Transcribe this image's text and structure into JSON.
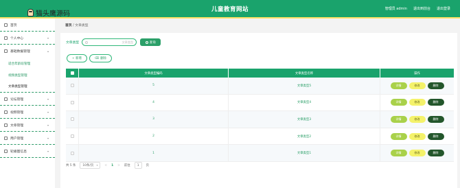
{
  "header": {
    "logo_text": "猫头鹰源码",
    "title": "儿童教育网站",
    "user_label": "管理员 admin",
    "links": [
      "退出到前台",
      "退出登录"
    ]
  },
  "sidebar": {
    "items": [
      {
        "label": "首页",
        "icon": "home-icon",
        "chevron": false
      },
      {
        "label": "个人中心",
        "icon": "user-icon",
        "chevron": true
      },
      {
        "label": "基础数据管理",
        "icon": "database-icon",
        "chevron": true,
        "expanded": true,
        "children": [
          "适合年龄段管理",
          "视频类型管理",
          "文章类型管理"
        ],
        "active_child": 2
      },
      {
        "label": "论坛管理",
        "icon": "forum-icon",
        "chevron": true
      },
      {
        "label": "视频管理",
        "icon": "video-icon",
        "chevron": true
      },
      {
        "label": "文章管理",
        "icon": "article-icon",
        "chevron": true
      },
      {
        "label": "用户管理",
        "icon": "users-icon",
        "chevron": true
      },
      {
        "label": "轮播图信息",
        "icon": "carousel-icon",
        "chevron": true
      }
    ]
  },
  "breadcrumb": {
    "home": "首页",
    "sep": "/",
    "current": "文章类型"
  },
  "search": {
    "label": "文章类型",
    "placeholder": "文章类型",
    "button": "查询"
  },
  "actions": {
    "add": "+ 新增",
    "delete": "删除"
  },
  "table": {
    "columns": [
      "文章类型编码",
      "文章类型名称",
      "操作"
    ],
    "rows": [
      {
        "code": "5",
        "name": "文章类型5"
      },
      {
        "code": "4",
        "name": "文章类型4"
      },
      {
        "code": "3",
        "name": "文章类型3"
      },
      {
        "code": "2",
        "name": "文章类型2"
      },
      {
        "code": "1",
        "name": "文章类型1"
      }
    ],
    "row_buttons": {
      "detail": "详情",
      "edit": "修改",
      "delete": "删除"
    }
  },
  "pagination": {
    "total": "共 5 条",
    "page_size": "10条/页",
    "prev": "<",
    "current_page": "1",
    "next": ">",
    "goto_label": "前往",
    "goto_value": "1",
    "page_unit": "页"
  },
  "colors": {
    "primary": "#1aa36c",
    "accent": "#ffe066",
    "detail": "#a9d14a",
    "edit": "#f4f26a",
    "delete": "#23562b"
  }
}
